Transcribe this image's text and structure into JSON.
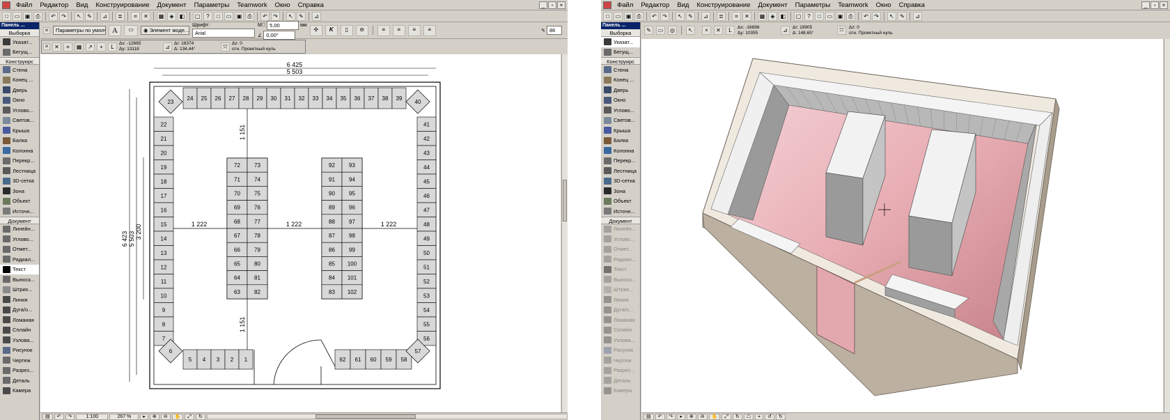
{
  "menu": [
    "Файл",
    "Редактор",
    "Вид",
    "Конструирование",
    "Документ",
    "Параметры",
    "Teamwork",
    "Окно",
    "Справка"
  ],
  "toolbox": {
    "title": "Панель ...",
    "selection_label": "Выборка",
    "arrow_tools": [
      "Указат...",
      "Бегущ..."
    ],
    "construct_section": "Конструирс",
    "construct_tools": [
      "Стена",
      "Конец ...",
      "Дверь",
      "Окно",
      "Углово...",
      "Светов...",
      "Крыша",
      "Балка",
      "Колонна",
      "Перекр...",
      "Лестница",
      "3D-сетка",
      "Зона",
      "Объект",
      "Источн..."
    ],
    "document_section": "Документ",
    "document_tools": [
      "Линейн...",
      "Углово...",
      "Отмет...",
      "Радиал...",
      "Текст",
      "Выноск...",
      "Штрих...",
      "Линия",
      "Дуга/о...",
      "Ломаная",
      "Сплайн",
      "Узлова...",
      "Рисунок",
      "Чертеж",
      "Разрез...",
      "Деталь",
      "Камера"
    ]
  },
  "left": {
    "infobar": {
      "params": "Параметры по умолч.",
      "model_element": "Элемент моде...",
      "font_label": "Шрифт:",
      "font_value": "Arial",
      "size_value": "5,00",
      "size_unit": "мм",
      "angle_value": "0,00°",
      "zoom_value": "86"
    },
    "coords": {
      "dx": "Δx: -12665",
      "dy": "Δy: 13118",
      "dr": "Δr: 18374",
      "da": "Δ: 134,44°",
      "dz": "Δz: 0",
      "ref": "отн. Проектный нуль"
    },
    "plan": {
      "dim_top_outer": "6 425",
      "dim_top_inner": "5 503",
      "dim_left_outer": "6 423",
      "dim_left_mid": "5 503",
      "dim_left_inner": "3 200",
      "dim_vertical": "1 151",
      "dim_horizontal": "1 222",
      "top_row": [
        "24",
        "25",
        "26",
        "27",
        "28",
        "29",
        "30",
        "31",
        "32",
        "33",
        "34",
        "35",
        "36",
        "37",
        "38",
        "39"
      ],
      "left_col": [
        "22",
        "21",
        "20",
        "19",
        "18",
        "17",
        "16",
        "15",
        "14",
        "13",
        "12",
        "11",
        "10",
        "9",
        "8",
        "7"
      ],
      "right_col": [
        "41",
        "42",
        "43",
        "44",
        "45",
        "46",
        "47",
        "48",
        "49",
        "50",
        "51",
        "52",
        "53",
        "54",
        "55",
        "56"
      ],
      "bottom_left": [
        "5",
        "4",
        "3",
        "2",
        "1"
      ],
      "bottom_right": [
        "62",
        "61",
        "60",
        "59",
        "58"
      ],
      "corners": [
        "23",
        "40",
        "6",
        "57"
      ],
      "island1_left": [
        "72",
        "71",
        "70",
        "69",
        "68",
        "67",
        "66",
        "65",
        "64",
        "63"
      ],
      "island1_right": [
        "73",
        "74",
        "75",
        "76",
        "77",
        "78",
        "79",
        "80",
        "81",
        "82"
      ],
      "island2_left": [
        "92",
        "91",
        "90",
        "89",
        "88",
        "87",
        "86",
        "85",
        "84",
        "83"
      ],
      "island2_right": [
        "93",
        "94",
        "95",
        "96",
        "97",
        "98",
        "99",
        "100",
        "101",
        "102"
      ]
    },
    "status": {
      "scale": "1:100",
      "zoom": "267 %"
    }
  },
  "right": {
    "coords": {
      "dx": "Δx: -16898",
      "dy": "Δy: 10355",
      "dr": "Δr: 19905",
      "da": "Δ: 148,65°",
      "dz": "Δz: 0",
      "ref": "отн. Проектный нуль"
    }
  },
  "colors": {
    "chrome": "#d4d0c8",
    "title_bar": "#0a246a",
    "floor_pink": "#e8aeb4",
    "wall_beige": "#c8bcac"
  }
}
